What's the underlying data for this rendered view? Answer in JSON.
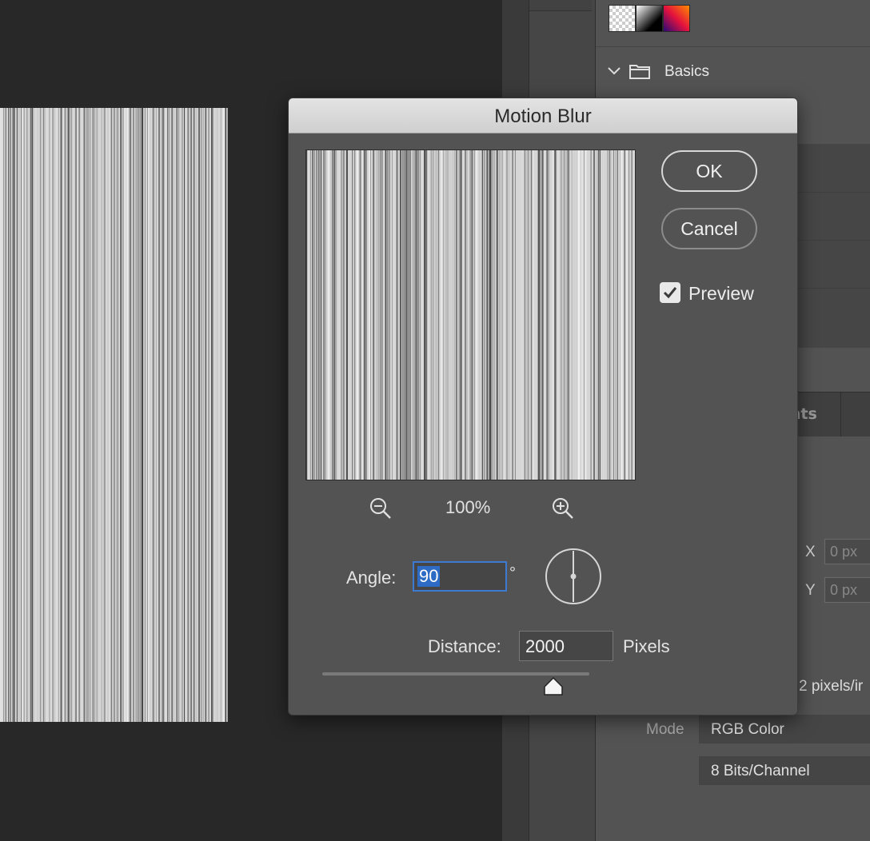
{
  "dialog": {
    "title": "Motion Blur",
    "zoom_level": "100%",
    "ok_label": "OK",
    "cancel_label": "Cancel",
    "preview_label": "Preview",
    "preview_checked": true,
    "angle_label": "Angle:",
    "angle_value": "90",
    "degree_symbol": "°",
    "distance_label": "Distance:",
    "distance_value": "2000",
    "distance_unit": "Pixels",
    "slider_fraction": 0.84,
    "icons": [
      "zoom-out-icon",
      "zoom-in-icon",
      "angle-dial-icon",
      "slider-thumb-icon",
      "checkmark-icon"
    ]
  },
  "panels": {
    "swatches": [
      "transparent",
      "black-white-gradient",
      "orange-purple-gradient"
    ],
    "basics_label": "Basics",
    "adjustments_tab_partial": "ents",
    "x_label": "X",
    "y_label": "Y",
    "x_placeholder": "0 px",
    "y_placeholder": "0 px",
    "resolution_partial": "2 pixels/ir",
    "mode_label": "Mode",
    "mode_value": "RGB Color",
    "bit_depth_value": "8 Bits/Channel"
  },
  "colors": {
    "dialog_bg": "#535353",
    "accent_blue": "#2d6bc5",
    "canvas_bg": "#282828"
  }
}
